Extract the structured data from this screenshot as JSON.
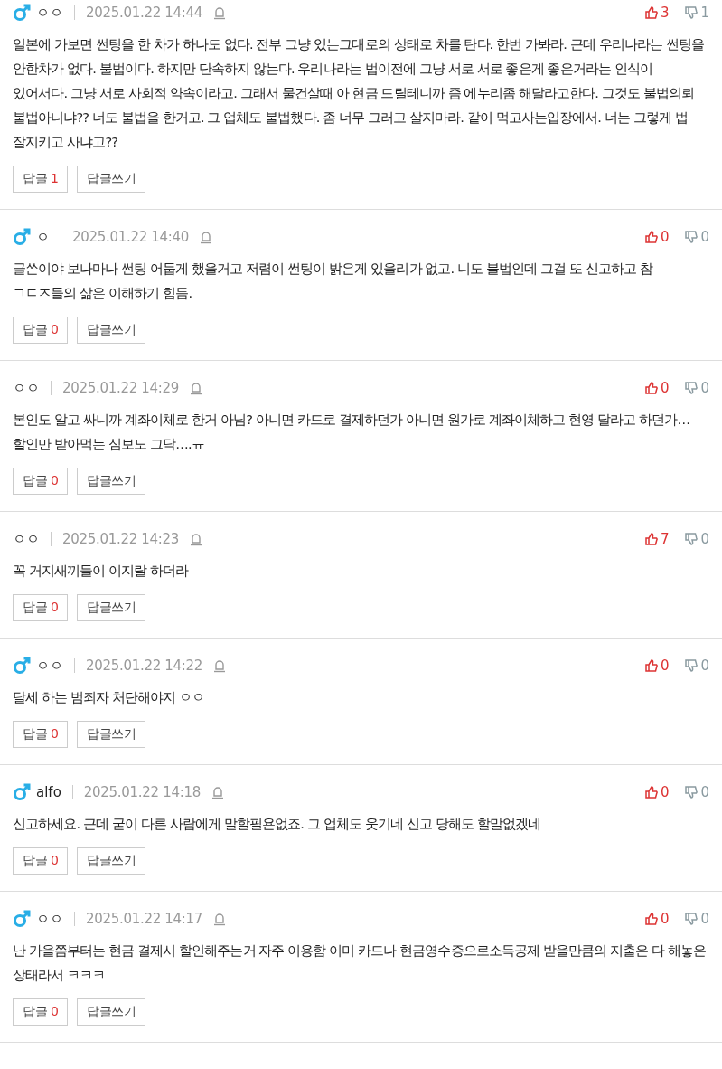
{
  "comments": [
    {
      "male": true,
      "nickname": "ㅇㅇ",
      "time": "2025.01.22 14:44",
      "likes": "3",
      "dislikes": "1",
      "text": "일본에 가보면 썬팅을 한 차가 하나도 없다. 전부 그냥 있는그대로의 상태로 차를 탄다. 한번 가봐라. 근데 우리나라는 썬팅을 안한차가 없다. 불법이다. 하지만 단속하지 않는다. 우리나라는 법이전에 그냥 서로 서로 좋은게 좋은거라는 인식이 있어서다. 그냥 서로 사회적 약속이라고. 그래서 물건살때 아 현금 드릴테니까 좀 에누리좀 해달라고한다. 그것도 불법의뢰 불법아니냐?? 너도 불법을 한거고. 그 업체도 불법했다. 좀 너무 그러고 살지마라. 같이 먹고사는입장에서. 너는 그렇게 법 잘지키고 사냐고??",
      "reply_label": "답글",
      "reply_count": "1",
      "write_label": "답글쓰기"
    },
    {
      "male": true,
      "nickname": "ㅇ",
      "time": "2025.01.22 14:40",
      "likes": "0",
      "dislikes": "0",
      "text": "글쓴이야 보나마나 썬팅 어둡게 했을거고 저렴이 썬팅이 밝은게 있을리가 없고. 니도 불법인데 그걸 또 신고하고 참 ㄱㄷㅈ들의 삶은 이해하기 힘듬.",
      "reply_label": "답글",
      "reply_count": "0",
      "write_label": "답글쓰기"
    },
    {
      "male": false,
      "nickname": "ㅇㅇ",
      "time": "2025.01.22 14:29",
      "likes": "0",
      "dislikes": "0",
      "text": "본인도 알고 싸니까 계좌이체로 한거 아님? 아니면 카드로 결제하던가 아니면 원가로 계좌이체하고 현영 달라고 하던가… 할인만 받아먹는 심보도 그닥….ㅠ",
      "reply_label": "답글",
      "reply_count": "0",
      "write_label": "답글쓰기"
    },
    {
      "male": false,
      "nickname": "ㅇㅇ",
      "time": "2025.01.22 14:23",
      "likes": "7",
      "dislikes": "0",
      "text": "꼭 거지새끼들이 이지랄 하더라",
      "reply_label": "답글",
      "reply_count": "0",
      "write_label": "답글쓰기"
    },
    {
      "male": true,
      "nickname": "ㅇㅇ",
      "time": "2025.01.22 14:22",
      "likes": "0",
      "dislikes": "0",
      "text": "탈세 하는 범죄자 처단해야지 ㅇㅇ",
      "reply_label": "답글",
      "reply_count": "0",
      "write_label": "답글쓰기"
    },
    {
      "male": true,
      "nickname": "alfo",
      "time": "2025.01.22 14:18",
      "likes": "0",
      "dislikes": "0",
      "text": "신고하세요. 근데 굳이 다른 사람에게 말할필욘없죠. 그 업체도 웃기네 신고 당해도 할말없겠네",
      "reply_label": "답글",
      "reply_count": "0",
      "write_label": "답글쓰기"
    },
    {
      "male": true,
      "nickname": "ㅇㅇ",
      "time": "2025.01.22 14:17",
      "likes": "0",
      "dislikes": "0",
      "text": "난 가을쯤부터는 현금 결제시 할인해주는거 자주 이용함 이미 카드나 현금영수증으로소득공제 받을만큼의 지출은 다 해놓은 상태라서 ㅋㅋㅋ",
      "reply_label": "답글",
      "reply_count": "0",
      "write_label": "답글쓰기"
    }
  ]
}
